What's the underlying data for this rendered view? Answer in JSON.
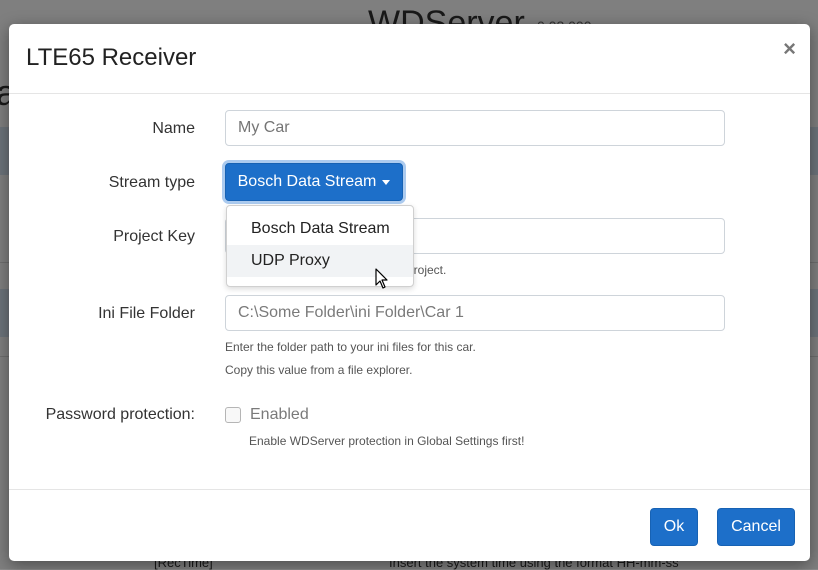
{
  "background": {
    "app_title": "WDServer",
    "version": "0.03.000",
    "partial_letter": "a",
    "rec_time": "[RecTime]",
    "insert_text": "Insert the system time using the format  HH-mm-ss"
  },
  "modal": {
    "title": "LTE65 Receiver",
    "close_glyph": "×",
    "fields": {
      "name": {
        "label": "Name",
        "value": "My Car"
      },
      "stream_type": {
        "label": "Stream type",
        "selected": "Bosch Data Stream",
        "options": [
          "Bosch Data Stream",
          "UDP Proxy"
        ]
      },
      "project_key": {
        "label": "Project Key",
        "value": "",
        "help_partial": "project."
      },
      "ini_folder": {
        "label": "Ini File Folder",
        "value": "C:\\Some Folder\\ini Folder\\Car 1",
        "help_1": "Enter the folder path to your ini files for this car.",
        "help_2": "Copy this value from a file explorer."
      },
      "password": {
        "label": "Password protection:",
        "checkbox_label": "Enabled",
        "checked": false,
        "help": "Enable WDServer protection in Global Settings first!"
      }
    },
    "buttons": {
      "ok": "Ok",
      "cancel": "Cancel"
    }
  },
  "colors": {
    "primary": "#1d6fc9",
    "highlight": "#f1f3f5"
  },
  "icons": {
    "close": "close-icon",
    "cursor": "mouse-pointer-icon",
    "caret": "caret-down-icon"
  }
}
